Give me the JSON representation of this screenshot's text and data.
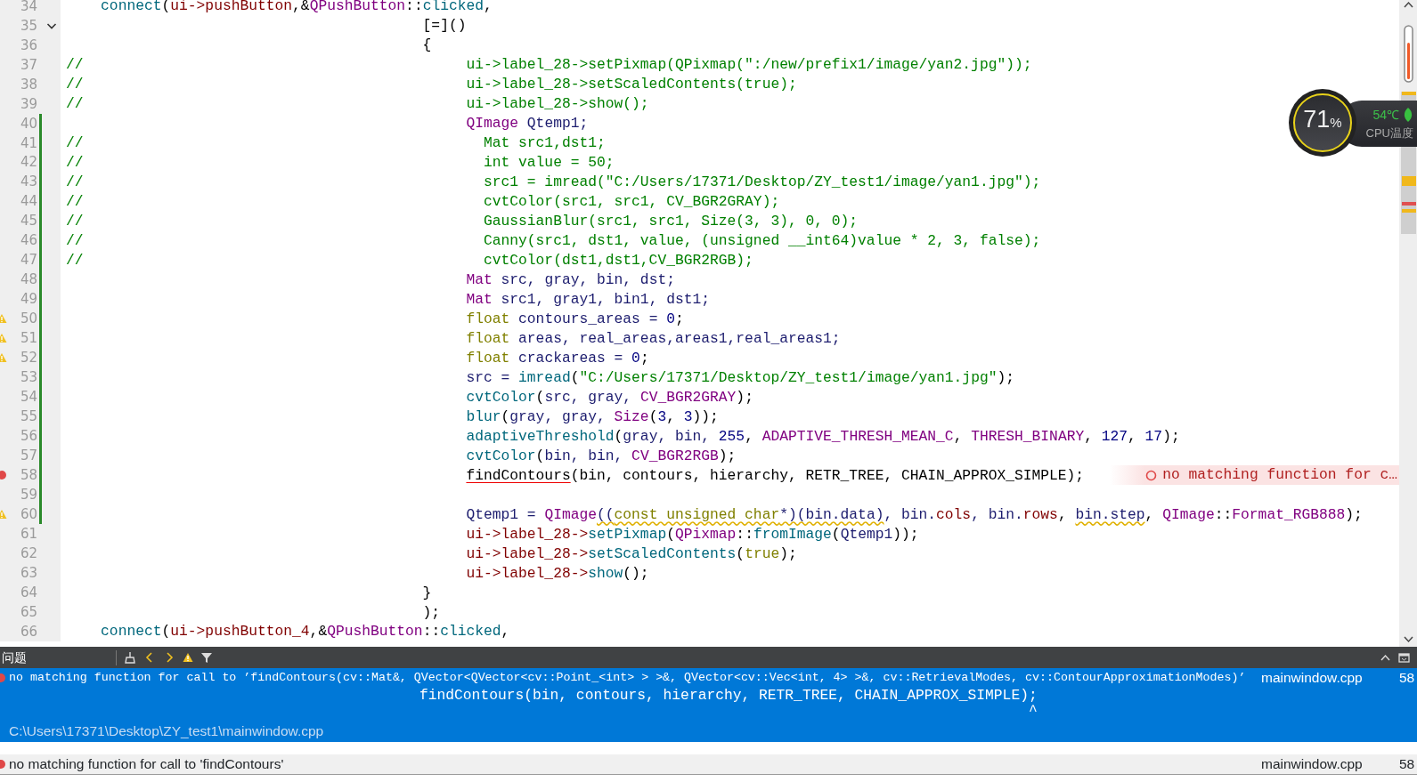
{
  "editor": {
    "lines": [
      {
        "number": "34",
        "warning": false,
        "error": false,
        "changed": false,
        "foldable": false,
        "tokens": [
          {
            "text": "    connect",
            "kind": "func"
          },
          {
            "text": "(",
            "kind": "plain"
          },
          {
            "text": "ui->pushButton",
            "kind": "member"
          },
          {
            "text": ",&",
            "kind": "plain"
          },
          {
            "text": "QPushButton",
            "kind": "type"
          },
          {
            "text": "::",
            "kind": "plain"
          },
          {
            "text": "clicked",
            "kind": "func"
          },
          {
            "text": ",",
            "kind": "plain"
          }
        ]
      },
      {
        "number": "35",
        "warning": false,
        "error": false,
        "changed": false,
        "foldable": true,
        "tokens": [
          {
            "text": "                                         [=]()",
            "kind": "plain"
          }
        ]
      },
      {
        "number": "36",
        "warning": false,
        "error": false,
        "changed": false,
        "foldable": false,
        "tokens": [
          {
            "text": "                                         {",
            "kind": "plain"
          }
        ]
      },
      {
        "number": "37",
        "warning": false,
        "error": false,
        "changed": false,
        "foldable": false,
        "tokens": [
          {
            "text": "//                                            ui->label_28->setPixmap(QPixmap(\":/new/prefix1/image/yan2.jpg\"));",
            "kind": "comment"
          }
        ]
      },
      {
        "number": "38",
        "warning": false,
        "error": false,
        "changed": false,
        "foldable": false,
        "tokens": [
          {
            "text": "//                                            ui->label_28->setScaledContents(true);",
            "kind": "comment"
          }
        ]
      },
      {
        "number": "39",
        "warning": false,
        "error": false,
        "changed": false,
        "foldable": false,
        "tokens": [
          {
            "text": "//                                            ui->label_28->show();",
            "kind": "comment"
          }
        ]
      },
      {
        "number": "40",
        "warning": false,
        "error": false,
        "changed": true,
        "foldable": false,
        "tokens": [
          {
            "text": "                                              QImage",
            "kind": "type"
          },
          {
            "text": " Qtemp1;",
            "kind": "var"
          }
        ]
      },
      {
        "number": "41",
        "warning": false,
        "error": false,
        "changed": true,
        "foldable": false,
        "tokens": [
          {
            "text": "//                                              Mat src1,dst1;",
            "kind": "comment"
          }
        ]
      },
      {
        "number": "42",
        "warning": false,
        "error": false,
        "changed": true,
        "foldable": false,
        "tokens": [
          {
            "text": "//                                              int value = 50;",
            "kind": "comment"
          }
        ]
      },
      {
        "number": "43",
        "warning": false,
        "error": false,
        "changed": true,
        "foldable": false,
        "tokens": [
          {
            "text": "//                                              src1 = imread(\"C:/Users/17371/Desktop/ZY_test1/image/yan1.jpg\");",
            "kind": "comment"
          }
        ]
      },
      {
        "number": "44",
        "warning": false,
        "error": false,
        "changed": true,
        "foldable": false,
        "tokens": [
          {
            "text": "//                                              cvtColor(src1, src1, CV_BGR2GRAY);",
            "kind": "comment"
          }
        ]
      },
      {
        "number": "45",
        "warning": false,
        "error": false,
        "changed": true,
        "foldable": false,
        "tokens": [
          {
            "text": "//                                              GaussianBlur(src1, src1, Size(3, 3), 0, 0);",
            "kind": "comment"
          }
        ]
      },
      {
        "number": "46",
        "warning": false,
        "error": false,
        "changed": true,
        "foldable": false,
        "tokens": [
          {
            "text": "//                                              Canny(src1, dst1, value, (unsigned __int64)value * 2, 3, false);",
            "kind": "comment"
          }
        ]
      },
      {
        "number": "47",
        "warning": false,
        "error": false,
        "changed": true,
        "foldable": false,
        "tokens": [
          {
            "text": "//                                              cvtColor(dst1,dst1,CV_BGR2RGB);",
            "kind": "comment"
          }
        ]
      },
      {
        "number": "48",
        "warning": false,
        "error": false,
        "changed": true,
        "foldable": false,
        "tokens": [
          {
            "text": "                                              Mat",
            "kind": "type"
          },
          {
            "text": " src, gray, bin, dst;",
            "kind": "var"
          }
        ]
      },
      {
        "number": "49",
        "warning": false,
        "error": false,
        "changed": true,
        "foldable": false,
        "tokens": [
          {
            "text": "                                              Mat",
            "kind": "type"
          },
          {
            "text": " src1, gray1, bin1, dst1;",
            "kind": "var"
          }
        ]
      },
      {
        "number": "50",
        "warning": true,
        "error": false,
        "changed": true,
        "foldable": false,
        "tokens": [
          {
            "text": "                                              float",
            "kind": "keyword"
          },
          {
            "text": " contours_areas = ",
            "kind": "var"
          },
          {
            "text": "0",
            "kind": "number"
          },
          {
            "text": ";",
            "kind": "plain"
          }
        ]
      },
      {
        "number": "51",
        "warning": true,
        "error": false,
        "changed": true,
        "foldable": false,
        "tokens": [
          {
            "text": "                                              float",
            "kind": "keyword"
          },
          {
            "text": " areas, real_areas,areas1,real_areas1;",
            "kind": "var"
          }
        ]
      },
      {
        "number": "52",
        "warning": true,
        "error": false,
        "changed": true,
        "foldable": false,
        "tokens": [
          {
            "text": "                                              float",
            "kind": "keyword"
          },
          {
            "text": " crackareas = ",
            "kind": "var"
          },
          {
            "text": "0",
            "kind": "number"
          },
          {
            "text": ";",
            "kind": "plain"
          }
        ]
      },
      {
        "number": "53",
        "warning": false,
        "error": false,
        "changed": true,
        "foldable": false,
        "tokens": [
          {
            "text": "                                              src = ",
            "kind": "var"
          },
          {
            "text": "imread",
            "kind": "func"
          },
          {
            "text": "(",
            "kind": "plain"
          },
          {
            "text": "\"C:/Users/17371/Desktop/ZY_test1/image/yan1.jpg\"",
            "kind": "string"
          },
          {
            "text": ");",
            "kind": "plain"
          }
        ]
      },
      {
        "number": "54",
        "warning": false,
        "error": false,
        "changed": true,
        "foldable": false,
        "tokens": [
          {
            "text": "                                              cvtColor",
            "kind": "func"
          },
          {
            "text": "(",
            "kind": "plain"
          },
          {
            "text": "src, gray, ",
            "kind": "var"
          },
          {
            "text": "CV_BGR2GRAY",
            "kind": "enum"
          },
          {
            "text": ");",
            "kind": "plain"
          }
        ]
      },
      {
        "number": "55",
        "warning": false,
        "error": false,
        "changed": true,
        "foldable": false,
        "tokens": [
          {
            "text": "                                              blur",
            "kind": "func"
          },
          {
            "text": "(",
            "kind": "plain"
          },
          {
            "text": "gray, gray, ",
            "kind": "var"
          },
          {
            "text": "Size",
            "kind": "type"
          },
          {
            "text": "(",
            "kind": "plain"
          },
          {
            "text": "3",
            "kind": "number"
          },
          {
            "text": ", ",
            "kind": "plain"
          },
          {
            "text": "3",
            "kind": "number"
          },
          {
            "text": "));",
            "kind": "plain"
          }
        ]
      },
      {
        "number": "56",
        "warning": false,
        "error": false,
        "changed": true,
        "foldable": false,
        "tokens": [
          {
            "text": "                                              adaptiveThreshold",
            "kind": "func"
          },
          {
            "text": "(",
            "kind": "plain"
          },
          {
            "text": "gray, bin, ",
            "kind": "var"
          },
          {
            "text": "255",
            "kind": "number"
          },
          {
            "text": ", ",
            "kind": "plain"
          },
          {
            "text": "ADAPTIVE_THRESH_MEAN_C",
            "kind": "enum"
          },
          {
            "text": ", ",
            "kind": "plain"
          },
          {
            "text": "THRESH_BINARY",
            "kind": "enum"
          },
          {
            "text": ", ",
            "kind": "plain"
          },
          {
            "text": "127",
            "kind": "number"
          },
          {
            "text": ", ",
            "kind": "plain"
          },
          {
            "text": "17",
            "kind": "number"
          },
          {
            "text": ");",
            "kind": "plain"
          }
        ]
      },
      {
        "number": "57",
        "warning": false,
        "error": false,
        "changed": true,
        "foldable": false,
        "tokens": [
          {
            "text": "                                              cvtColor",
            "kind": "func"
          },
          {
            "text": "(",
            "kind": "plain"
          },
          {
            "text": "bin, bin, ",
            "kind": "var"
          },
          {
            "text": "CV_BGR2RGB",
            "kind": "enum"
          },
          {
            "text": ");",
            "kind": "plain"
          }
        ]
      },
      {
        "number": "58",
        "warning": false,
        "error": true,
        "changed": true,
        "foldable": false,
        "tokens": [
          {
            "text": "                                              findContours",
            "kind": "error"
          },
          {
            "text": "(bin, contours, hierarchy, RETR_TREE, CHAIN_APPROX_SIMPLE);",
            "kind": "plain"
          }
        ],
        "annotation": "no matching function for c…"
      },
      {
        "number": "59",
        "warning": false,
        "error": false,
        "changed": true,
        "foldable": false
      },
      {
        "number": "60",
        "warning": true,
        "error": false,
        "changed": true,
        "foldable": false,
        "tokens": [
          {
            "text": "                                              Qtemp1 = ",
            "kind": "var"
          },
          {
            "text": "QImage",
            "kind": "type"
          },
          {
            "text": "((",
            "kind": "warn"
          },
          {
            "text": "const unsigned char",
            "kind": "warnkeyword"
          },
          {
            "text": "*)(bin.data)",
            "kind": "warn"
          },
          {
            "text": ", bin.",
            "kind": "var"
          },
          {
            "text": "cols",
            "kind": "member"
          },
          {
            "text": ", bin.",
            "kind": "var"
          },
          {
            "text": "rows",
            "kind": "member"
          },
          {
            "text": ", ",
            "kind": "plain"
          },
          {
            "text": "bin.step",
            "kind": "warn"
          },
          {
            "text": ", ",
            "kind": "plain"
          },
          {
            "text": "QImage",
            "kind": "type"
          },
          {
            "text": "::",
            "kind": "plain"
          },
          {
            "text": "Format_RGB888",
            "kind": "enum"
          },
          {
            "text": ");",
            "kind": "plain"
          }
        ]
      },
      {
        "number": "61",
        "warning": false,
        "error": false,
        "changed": false,
        "foldable": false,
        "tokens": [
          {
            "text": "                                              ui->label_28->",
            "kind": "member"
          },
          {
            "text": "setPixmap",
            "kind": "func"
          },
          {
            "text": "(",
            "kind": "plain"
          },
          {
            "text": "QPixmap",
            "kind": "type"
          },
          {
            "text": "::",
            "kind": "plain"
          },
          {
            "text": "fromImage",
            "kind": "func"
          },
          {
            "text": "(",
            "kind": "plain"
          },
          {
            "text": "Qtemp1",
            "kind": "var"
          },
          {
            "text": "));",
            "kind": "plain"
          }
        ]
      },
      {
        "number": "62",
        "warning": false,
        "error": false,
        "changed": false,
        "foldable": false,
        "tokens": [
          {
            "text": "                                              ui->label_28->",
            "kind": "member"
          },
          {
            "text": "setScaledContents",
            "kind": "func"
          },
          {
            "text": "(",
            "kind": "plain"
          },
          {
            "text": "true",
            "kind": "keyword"
          },
          {
            "text": ");",
            "kind": "plain"
          }
        ]
      },
      {
        "number": "63",
        "warning": false,
        "error": false,
        "changed": false,
        "foldable": false,
        "tokens": [
          {
            "text": "                                              ui->label_28->",
            "kind": "member"
          },
          {
            "text": "show",
            "kind": "func"
          },
          {
            "text": "();",
            "kind": "plain"
          }
        ]
      },
      {
        "number": "64",
        "warning": false,
        "error": false,
        "changed": false,
        "foldable": false,
        "tokens": [
          {
            "text": "                                         }",
            "kind": "plain"
          }
        ]
      },
      {
        "number": "65",
        "warning": false,
        "error": false,
        "changed": false,
        "foldable": false,
        "tokens": [
          {
            "text": "                                         );",
            "kind": "plain"
          }
        ]
      },
      {
        "number": "66",
        "warning": false,
        "error": false,
        "changed": false,
        "foldable": false,
        "tokens": [
          {
            "text": "    connect",
            "kind": "func"
          },
          {
            "text": "(",
            "kind": "plain"
          },
          {
            "text": "ui->pushButton_4",
            "kind": "member"
          },
          {
            "text": ",&",
            "kind": "plain"
          },
          {
            "text": "QPushButton",
            "kind": "type"
          },
          {
            "text": "::",
            "kind": "plain"
          },
          {
            "text": "clicked",
            "kind": "func"
          },
          {
            "text": ",",
            "kind": "plain"
          }
        ]
      }
    ]
  },
  "cpu_widget": {
    "usage": "71",
    "unit": "%",
    "temperature": "54℃",
    "label": "CPU温度"
  },
  "issues_panel": {
    "title": "问题",
    "items": [
      {
        "selected": true,
        "message": "no matching function for call to ’findContours(cv::Mat&, QVector<QVector<cv::Point_<int> > >&, QVector<cv::Vec<int, 4> >&, cv::RetrievalModes, cv::ContourApproximationModes)’",
        "file": "mainwindow.cpp",
        "line": "58",
        "source_line": "findContours(bin, contours, hierarchy, RETR_TREE, CHAIN_APPROX_SIMPLE);",
        "caret": "                                                                      ^",
        "path": "C:\\Users\\17371\\Desktop\\ZY_test1\\mainwindow.cpp"
      }
    ]
  },
  "status_bar": {
    "message": "no matching function for call to 'findContours'",
    "file": "mainwindow.cpp",
    "line": "58"
  }
}
